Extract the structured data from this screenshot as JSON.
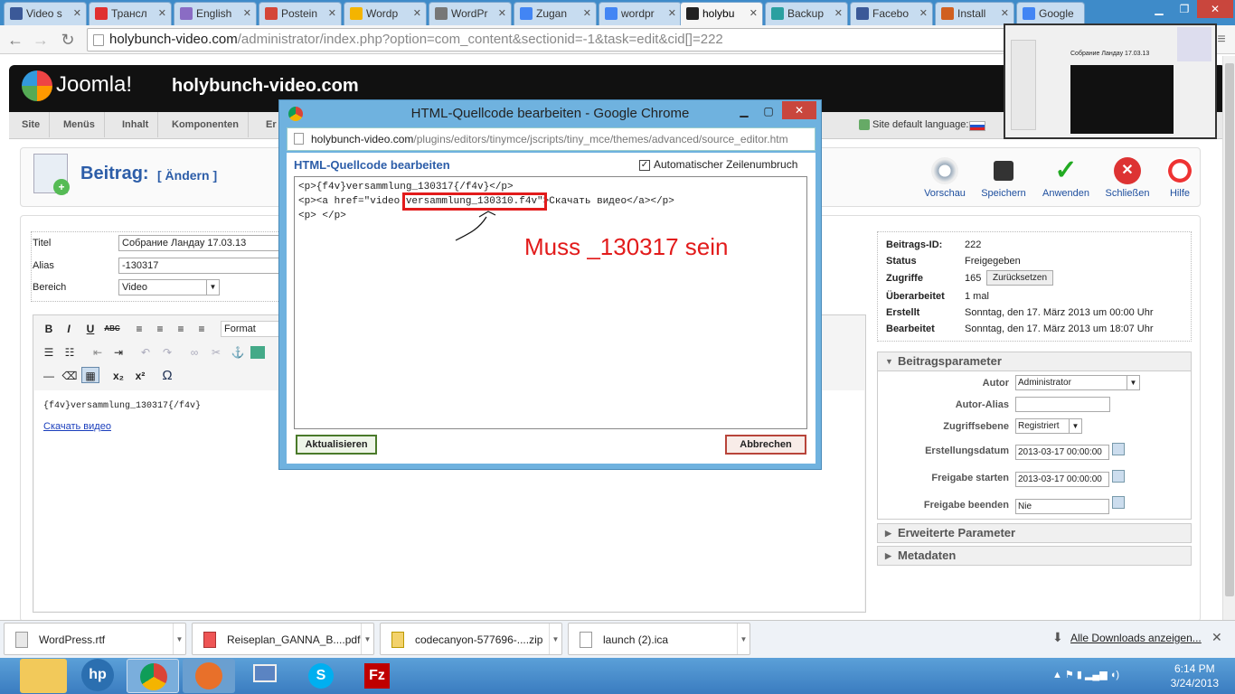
{
  "tabs": [
    {
      "label": "Video s",
      "color": "#3b5998"
    },
    {
      "label": "Трансл",
      "color": "#e03030"
    },
    {
      "label": "English",
      "color": "#8a6cc4"
    },
    {
      "label": "Postein",
      "color": "#d44638"
    },
    {
      "label": "Wordp",
      "color": "#f4b400"
    },
    {
      "label": "WordPr",
      "color": "#777777"
    },
    {
      "label": "Zugan",
      "color": "#4285f4"
    },
    {
      "label": "wordpr",
      "color": "#4285f4"
    },
    {
      "label": "holybu",
      "color": "#222222"
    },
    {
      "label": "Backup",
      "color": "#2aa0a0"
    },
    {
      "label": "Facebo",
      "color": "#3b5998"
    },
    {
      "label": "Install",
      "color": "#d06020"
    },
    {
      "label": "Google",
      "color": "#4285f4"
    }
  ],
  "omnibox": {
    "host": "holybunch-video.com",
    "path": "/administrator/index.php?option=com_content&sectionid=-1&task=edit&cid[]=222"
  },
  "joomla": {
    "logo": "Joomla!",
    "site": "holybunch-video.com",
    "site_lang": "Site default language:"
  },
  "menu": [
    "Site",
    "Menüs",
    "Inhalt",
    "Komponenten",
    "Er"
  ],
  "page": {
    "title": "Beitrag:",
    "subtitle": "[ Ändern ]"
  },
  "toolbar": [
    "Vorschau",
    "Speichern",
    "Anwenden",
    "Schließen",
    "Hilfe"
  ],
  "form": {
    "title_label": "Titel",
    "title_value": "Собрание Ландау 17.03.13",
    "alias_label": "Alias",
    "alias_value": "-130317",
    "section_label": "Bereich",
    "section_value": "Video"
  },
  "editor": {
    "format": "Format",
    "line1": "{f4v}versammlung_130317{/f4v}",
    "link": "Скачать видео"
  },
  "info": [
    {
      "k": "Beitrags-ID:",
      "v": "222"
    },
    {
      "k": "Status",
      "v": "Freigegeben"
    },
    {
      "k": "Zugriffe",
      "v": "165"
    },
    {
      "k": "Überarbeitet",
      "v": "1 mal"
    },
    {
      "k": "Erstellt",
      "v": "Sonntag, den 17. März 2013 um 00:00 Uhr"
    },
    {
      "k": "Bearbeitet",
      "v": "Sonntag, den 17. März 2013 um 18:07 Uhr"
    }
  ],
  "reset_button": "Zurücksetzen",
  "params": {
    "header": "Beitragsparameter",
    "author_label": "Autor",
    "author_value": "Administrator",
    "alias_label": "Autor-Alias",
    "alias_value": "",
    "access_label": "Zugriffsebene",
    "access_value": "Registriert",
    "created_label": "Erstellungsdatum",
    "created_value": "2013-03-17 00:00:00",
    "pub_start_label": "Freigabe starten",
    "pub_start_value": "2013-03-17 00:00:00",
    "pub_end_label": "Freigabe beenden",
    "pub_end_value": "Nie"
  },
  "extended": "Erweiterte Parameter",
  "metadata": "Metadaten",
  "popup": {
    "title": "HTML-Quellcode bearbeiten - Google Chrome",
    "url_host": "holybunch-video.com",
    "url_path": "/plugins/editors/tinymce/jscripts/tiny_mce/themes/advanced/source_editor.htm",
    "heading": "HTML-Quellcode bearbeiten",
    "wrap_label": "Automatischer Zeilenumbruch",
    "code1": "<p>{f4v}versammlung_130317{/f4v}</p>",
    "code2a": "<p><a href=\"video.",
    "code2b": "versammlung_130310.f4v\"",
    "code2c": ">Скачать видео</a></p>",
    "code3": "<p> </p>",
    "update_btn": "Aktualisieren",
    "cancel_btn": "Abbrechen",
    "annotation": "Muss _130317 sein"
  },
  "thumb_title": "Собрание Ландау 17.03.13",
  "downloads": [
    {
      "name": "WordPress.rtf"
    },
    {
      "name": "Reiseplan_GANNA_B....pdf"
    },
    {
      "name": "codecanyon-577696-....zip"
    },
    {
      "name": "launch (2).ica"
    }
  ],
  "dl_all": "Alle Downloads anzeigen...",
  "clock": {
    "time": "6:14 PM",
    "date": "3/24/2013"
  }
}
